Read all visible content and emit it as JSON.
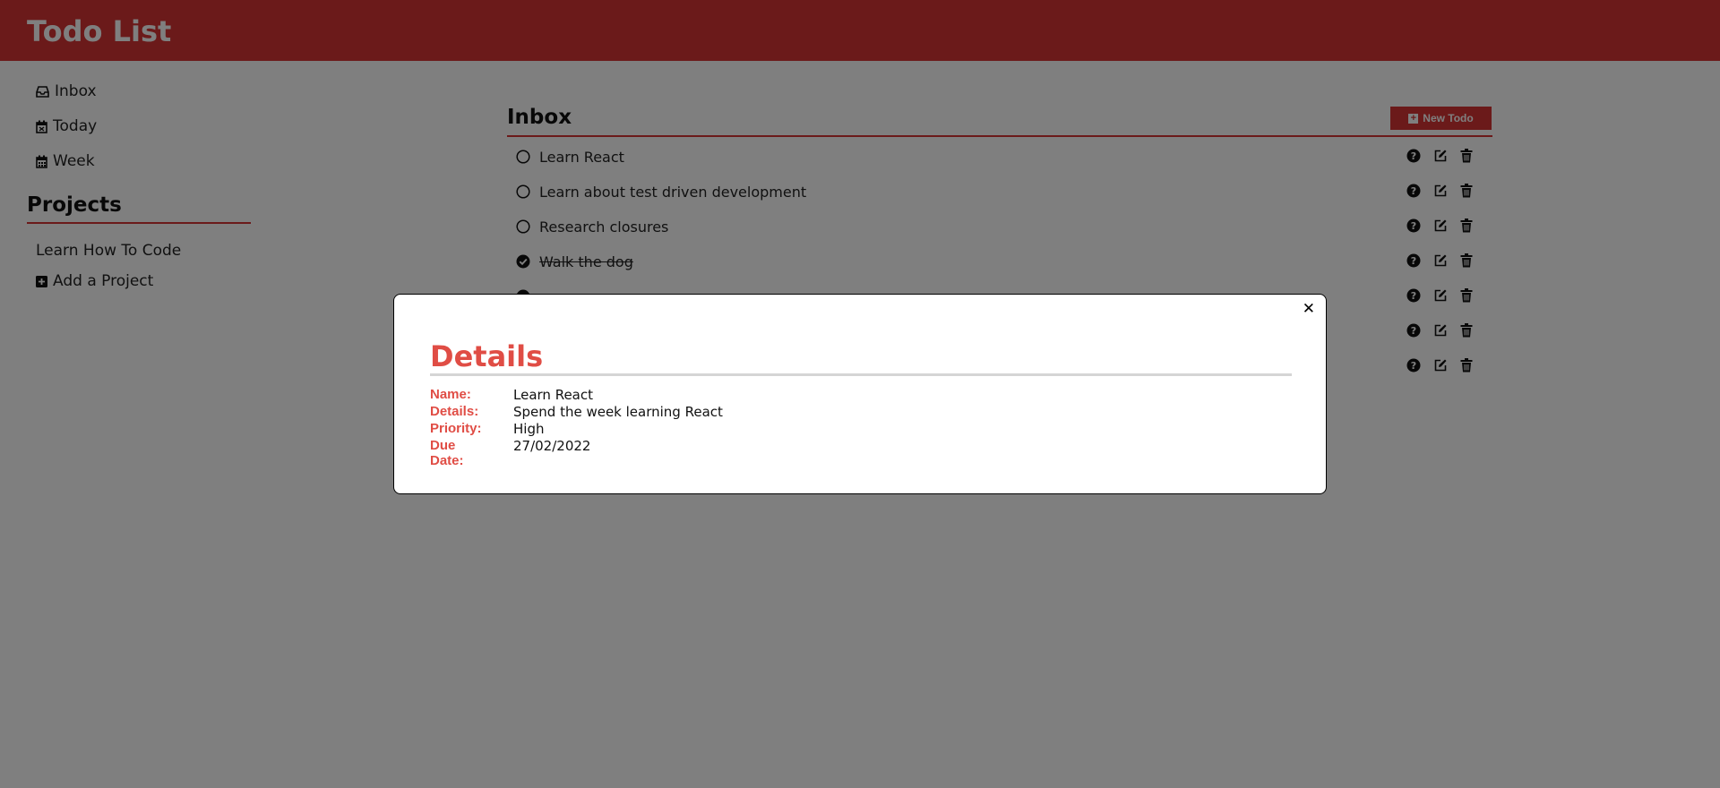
{
  "header": {
    "title": "Todo List"
  },
  "sidebar": {
    "nav": [
      {
        "label": "Inbox",
        "icon": "inbox-icon"
      },
      {
        "label": "Today",
        "icon": "calendar-day-icon"
      },
      {
        "label": "Week",
        "icon": "calendar-week-icon"
      }
    ],
    "projects_title": "Projects",
    "projects": [
      {
        "label": "Learn How To Code"
      }
    ],
    "add_project_label": "Add a Project"
  },
  "main": {
    "title": "Inbox",
    "new_todo_label": "New Todo",
    "todos": [
      {
        "text": "Learn React",
        "done": false
      },
      {
        "text": "Learn about test driven development",
        "done": false
      },
      {
        "text": "Research closures",
        "done": false
      },
      {
        "text": "Walk the dog",
        "done": true
      },
      {
        "text": "",
        "done": true
      },
      {
        "text": "",
        "done": false
      },
      {
        "text": "",
        "done": false
      }
    ]
  },
  "modal": {
    "title": "Details",
    "close_label": "✕",
    "fields": [
      {
        "label": "Name:",
        "value": "Learn React"
      },
      {
        "label": "Details:",
        "value": "Spend the week learning React"
      },
      {
        "label": "Priority:",
        "value": "High"
      },
      {
        "label": "Due Date:",
        "value": "27/02/2022"
      }
    ]
  },
  "colors": {
    "brand": "#d63535",
    "accent_text": "#e04d45",
    "overlay": "rgba(0,0,0,0.5)"
  }
}
